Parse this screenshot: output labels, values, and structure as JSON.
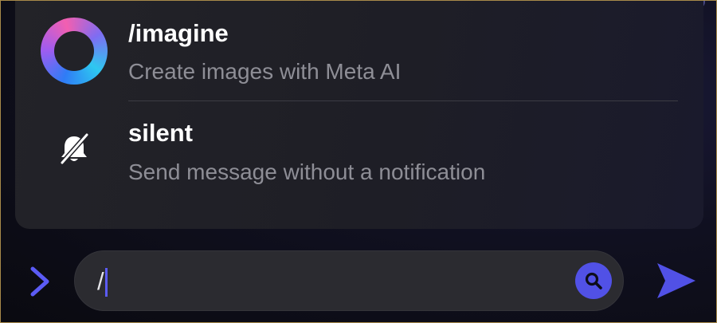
{
  "suggestions": [
    {
      "command": "/imagine",
      "description": "Create images with Meta AI",
      "icon": "meta-ai-ring-icon"
    },
    {
      "command": "silent",
      "description": "Send message without a notification",
      "icon": "bell-off-icon"
    }
  ],
  "composer": {
    "input_value": "/",
    "expand_icon": "chevron-right-icon",
    "search_icon": "search-icon",
    "send_icon": "send-icon"
  },
  "colors": {
    "accent": "#5151e6",
    "popup_bg": "#222228",
    "secondary_text": "#8e8e96",
    "frame_border": "#a88a4a"
  }
}
